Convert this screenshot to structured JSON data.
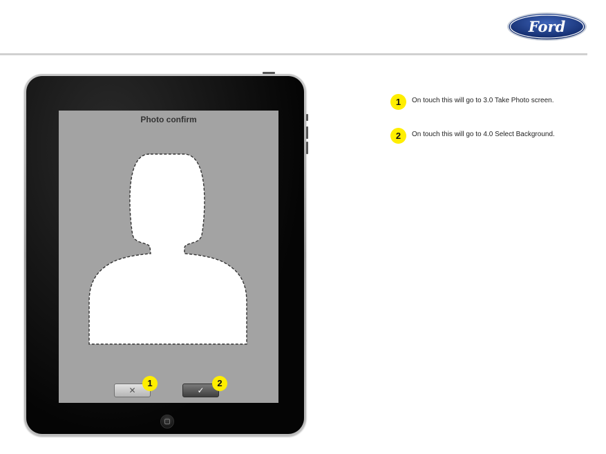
{
  "brand": {
    "logo_text": "Ford",
    "colors": {
      "oval": "#1b3a8c",
      "rim": "#c7ced9",
      "text": "#ffffff"
    }
  },
  "screen": {
    "title": "Photo confirm",
    "background": "#a3a3a3",
    "cancel_button": {
      "icon": "close-icon",
      "glyph": "✕"
    },
    "confirm_button": {
      "icon": "check-icon",
      "glyph": "✓"
    },
    "silhouette": {
      "icon": "person-silhouette-icon"
    }
  },
  "markers": {
    "cancel": "1",
    "confirm": "2",
    "color": "#ffee00"
  },
  "annotations": [
    {
      "number": "1",
      "text": "On touch this will go to 3.0 Take Photo screen."
    },
    {
      "number": "2",
      "text": "On touch this will go to 4.0 Select Background."
    }
  ]
}
